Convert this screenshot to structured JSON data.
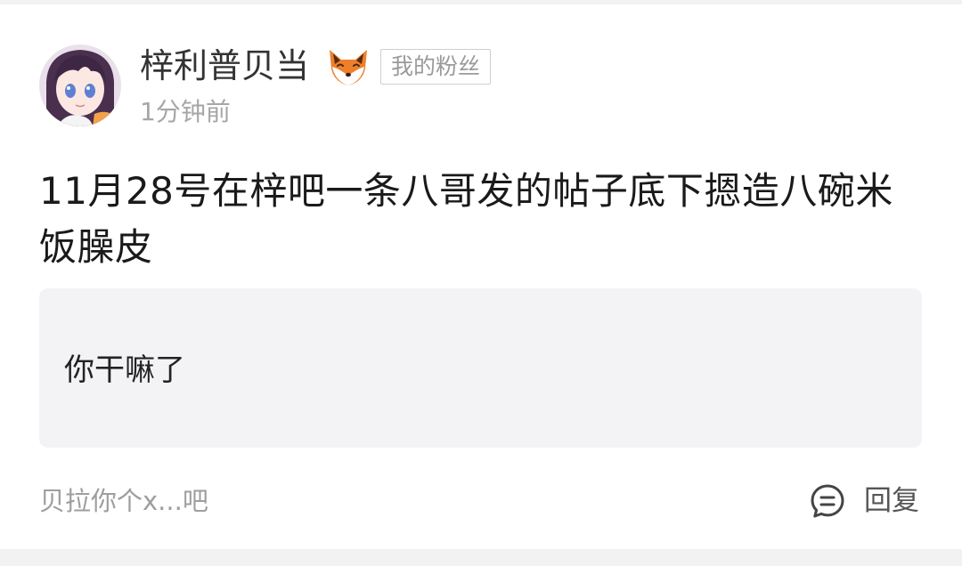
{
  "post": {
    "username": "梓利普贝当",
    "fan_badge": "我的粉丝",
    "time": "1分钟前",
    "text": "11月28号在梓吧一条八哥发的帖子底下摁造八碗米饭臊皮"
  },
  "quote": {
    "text": "你干嘛了"
  },
  "footer": {
    "preview": "贝拉你个x...吧",
    "reply_label": "回复"
  },
  "icons": {
    "avatar": "anime-avatar",
    "fox": "fox-emoji-icon",
    "reply": "comment-icon"
  },
  "colors": {
    "background": "#f2f2f2",
    "card": "#ffffff",
    "quote_background": "#f3f3f5",
    "muted_text": "#9e9e9e",
    "primary_text": "#1a1a1a"
  }
}
